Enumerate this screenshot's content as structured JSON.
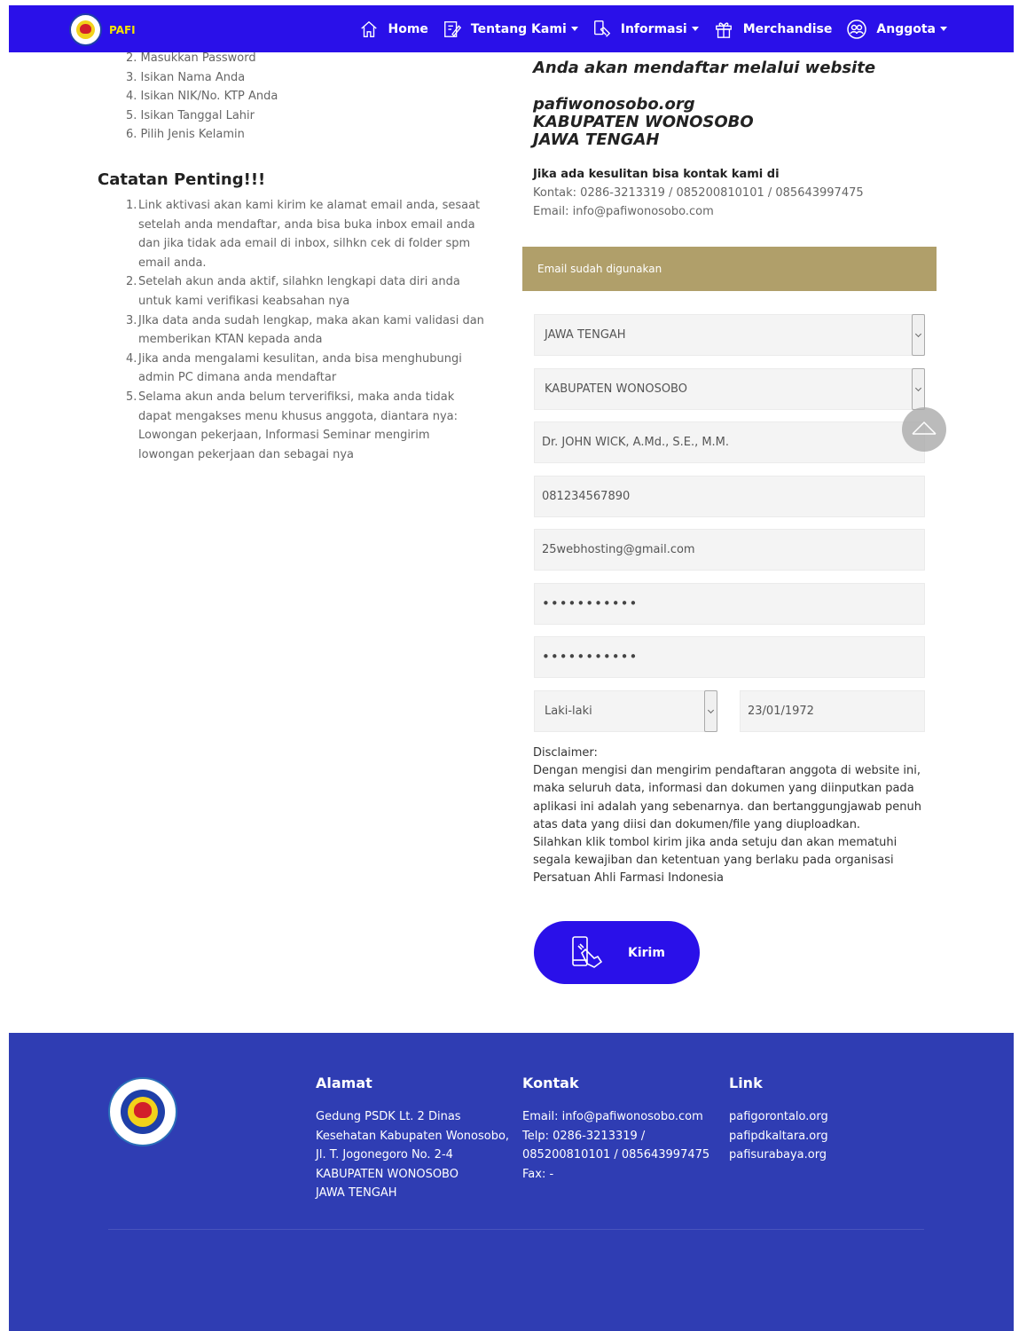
{
  "nav": {
    "brand": "PAFI",
    "items": [
      {
        "label": "Home",
        "dropdown": false
      },
      {
        "label": "Tentang Kami",
        "dropdown": true
      },
      {
        "label": "Informasi",
        "dropdown": true
      },
      {
        "label": "Merchandise",
        "dropdown": false
      },
      {
        "label": "Anggota",
        "dropdown": true
      }
    ]
  },
  "steps": [
    "2. Masukkan Password",
    "3. Isikan Nama Anda",
    "4. Isikan NIK/No. KTP Anda",
    "5. Isikan Tanggal Lahir",
    "6. Pilih Jenis Kelamin"
  ],
  "notes": {
    "title": "Catatan Penting!!!",
    "items": [
      {
        "num": "1.",
        "text": "Link aktivasi akan kami kirim ke alamat email anda, sesaat setelah anda mendaftar, anda bisa buka inbox email anda dan jika tidak ada email di inbox, silhkn cek di folder spm email anda."
      },
      {
        "num": "2.",
        "text": "Setelah akun anda aktif, silahkn lengkapi data diri anda untuk kami verifikasi keabsahan nya"
      },
      {
        "num": "3.",
        "text": "JIka data anda sudah lengkap, maka akan kami validasi dan memberikan KTAN kepada anda"
      },
      {
        "num": "4.",
        "text": "Jika anda mengalami kesulitan, anda bisa menghubungi admin PC dimana anda mendaftar"
      },
      {
        "num": "5.",
        "text": "Selama akun anda belum terverifiksi, maka anda tidak dapat mengakses menu khusus anggota, diantara nya: Lowongan pekerjaan, Informasi Seminar mengirim lowongan pekerjaan dan sebagai nya"
      }
    ]
  },
  "register": {
    "heading": "Anda akan mendaftar melalui website",
    "site": "pafiwonosobo.org",
    "kabupaten": "KABUPATEN WONOSOBO",
    "provinsi": "JAWA TENGAH",
    "contact_label": "Jika ada kesulitan bisa kontak kami di",
    "contact_phone": "Kontak: 0286-3213319 / 085200810101 / 085643997475",
    "contact_email": "Email: info@pafiwonosobo.com"
  },
  "alert": "Email sudah digunakan",
  "form": {
    "provinsi": "JAWA TENGAH",
    "kabupaten": "KABUPATEN WONOSOBO",
    "nama": "Dr. JOHN WICK, A.Md., S.E., M.M.",
    "nik": "081234567890",
    "email": "25webhosting@gmail.com",
    "password": "•••••••••••",
    "password_confirm": "•••••••••••",
    "gender": "Laki-laki",
    "tanggal_lahir": "23/01/1972"
  },
  "disclaimer": {
    "title": "Disclaimer:",
    "p1": "Dengan mengisi dan mengirim pendaftaran anggota di website ini, maka seluruh data, informasi dan dokumen yang diinputkan pada aplikasi ini adalah yang sebenarnya. dan bertanggungjawab penuh atas data yang diisi dan dokumen/file yang diuploadkan.",
    "p2": "Silahkan klik tombol kirim jika anda setuju dan akan mematuhi segala kewajiban dan ketentuan yang berlaku pada organisasi Persatuan Ahli Farmasi Indonesia"
  },
  "submit_label": "Kirim",
  "footer": {
    "alamat": {
      "title": "Alamat",
      "lines": [
        "Gedung PSDK Lt. 2 Dinas",
        "Kesehatan Kabupaten Wonosobo,",
        "Jl. T. Jogonegoro No. 2-4",
        "KABUPATEN WONOSOBO",
        "JAWA TENGAH"
      ]
    },
    "kontak": {
      "title": "Kontak",
      "lines": [
        "Email: info@pafiwonosobo.com",
        "Telp: 0286-3213319 /",
        "085200810101 / 085643997475",
        "Fax: -"
      ]
    },
    "link": {
      "title": "Link",
      "lines": [
        "pafigorontalo.org",
        "pafipdkaltara.org",
        "pafisurabaya.org"
      ]
    }
  },
  "colors": {
    "nav_bg": "#2a10e9",
    "brand_text": "#f4e300",
    "alert_bg": "#b09f6a",
    "footer_bg": "#2f3db3",
    "button_bg": "#2a10e9"
  }
}
